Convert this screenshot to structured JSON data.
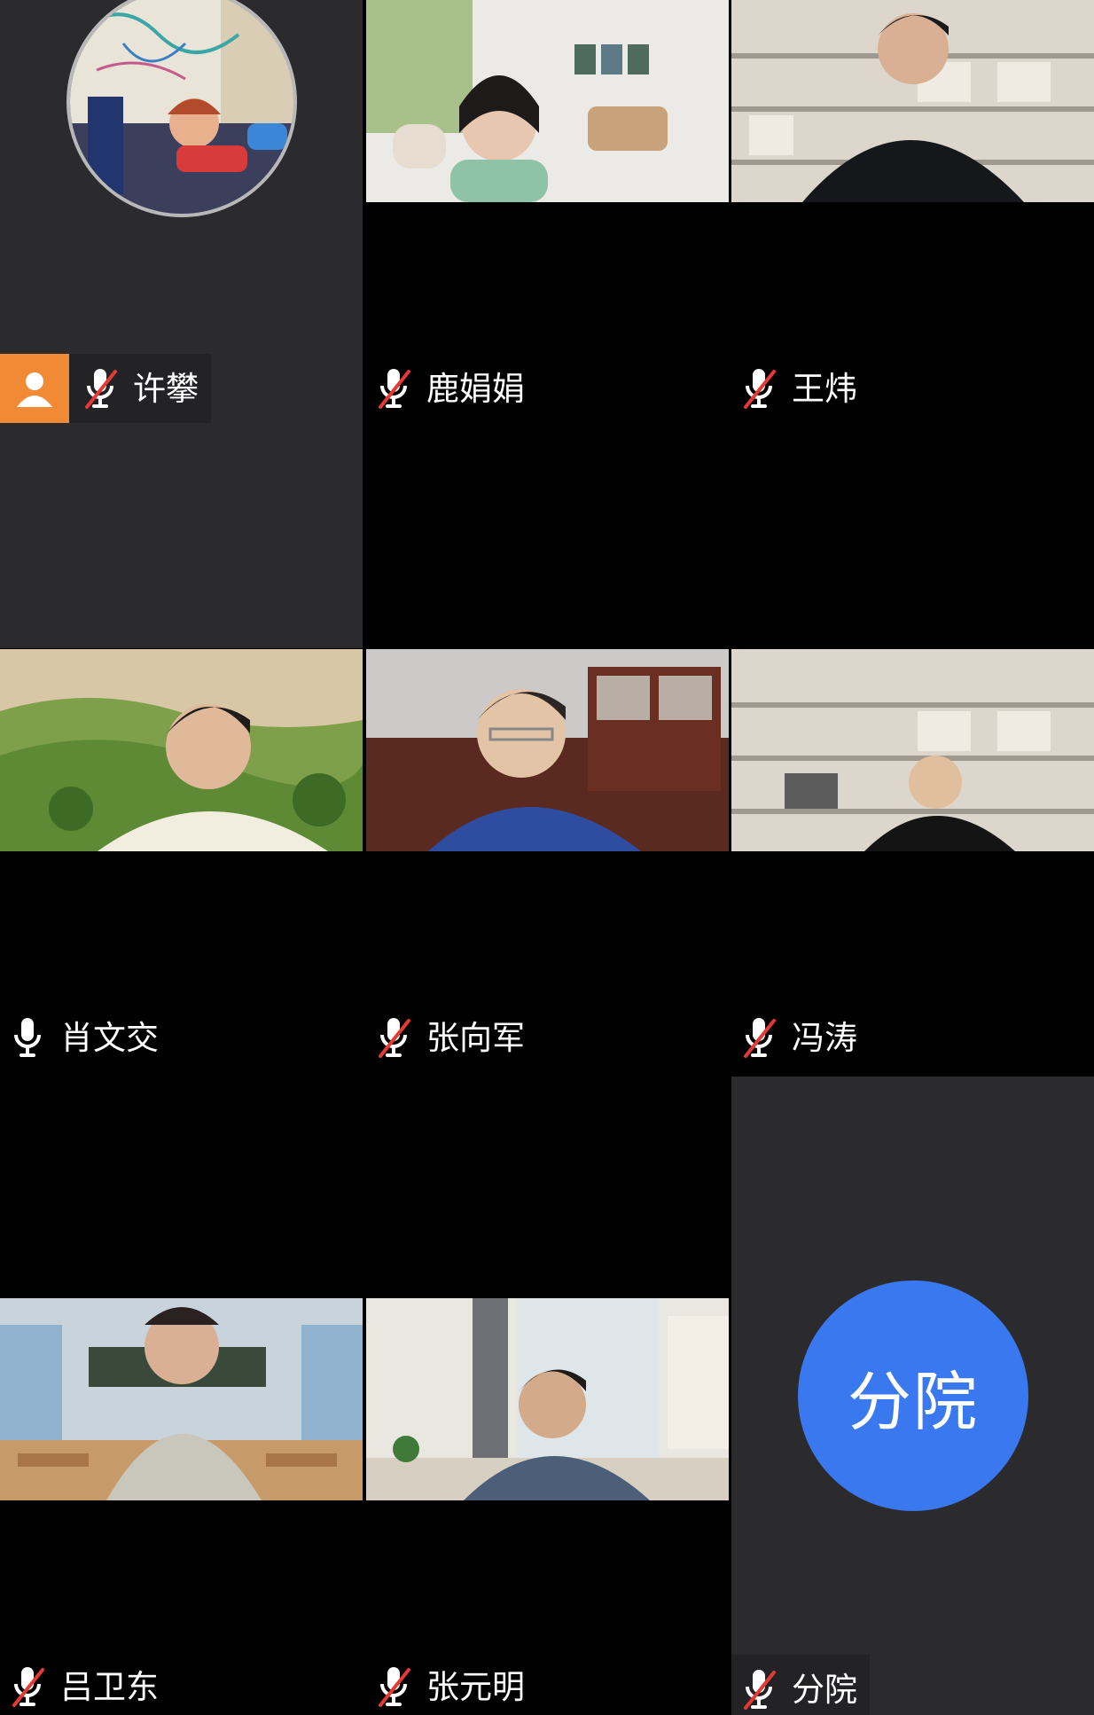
{
  "participants": [
    {
      "name": "许攀",
      "mic": "muted",
      "video": "avatar-image",
      "badge": "person-icon"
    },
    {
      "name": "鹿娟娟",
      "mic": "muted",
      "video": "camera"
    },
    {
      "name": "王炜",
      "mic": "muted",
      "video": "camera"
    },
    {
      "name": "肖文交",
      "mic": "on",
      "video": "camera"
    },
    {
      "name": "张向军",
      "mic": "muted",
      "video": "camera"
    },
    {
      "name": "冯涛",
      "mic": "muted",
      "video": "camera"
    },
    {
      "name": "吕卫东",
      "mic": "muted",
      "video": "camera"
    },
    {
      "name": "张元明",
      "mic": "muted",
      "video": "camera"
    },
    {
      "name": "分院",
      "mic": "muted",
      "video": "text-avatar",
      "avatar_text": "分院"
    }
  ],
  "colors": {
    "avatar_blue": "#3a78f0",
    "badge_orange": "#f08a34",
    "tile_dark": "#2b2b2e",
    "mute_red": "#e53935"
  }
}
